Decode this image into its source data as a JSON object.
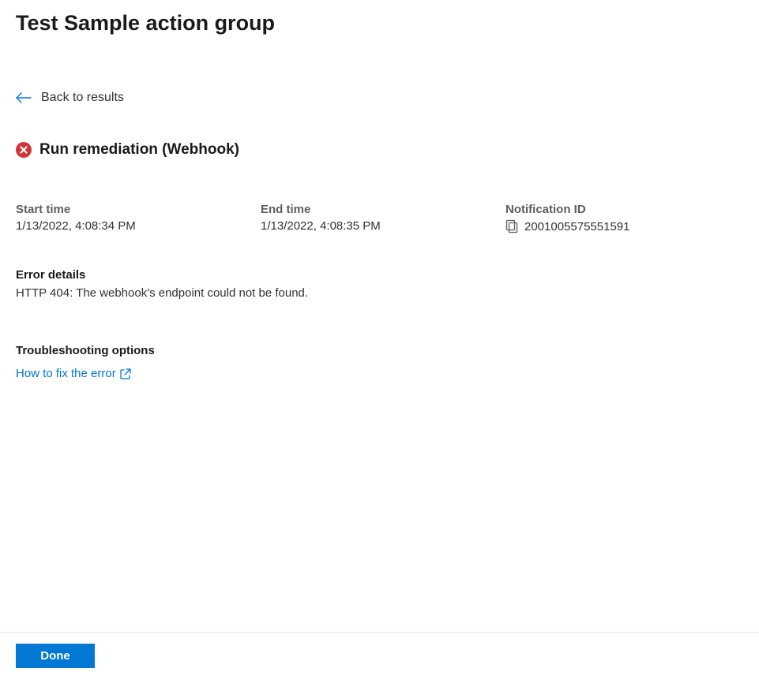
{
  "header": {
    "title": "Test Sample action group"
  },
  "nav": {
    "back_label": "Back to results"
  },
  "status": {
    "title": "Run remediation (Webhook)"
  },
  "details": {
    "start_time_label": "Start time",
    "start_time_value": "1/13/2022, 4:08:34 PM",
    "end_time_label": "End time",
    "end_time_value": "1/13/2022, 4:08:35 PM",
    "notification_id_label": "Notification ID",
    "notification_id_value": "2001005575551591"
  },
  "error": {
    "section_label": "Error details",
    "message": "HTTP 404: The webhook's endpoint could not be found."
  },
  "troubleshooting": {
    "section_label": "Troubleshooting options",
    "link_text": "How to fix the error"
  },
  "footer": {
    "done_label": "Done"
  }
}
